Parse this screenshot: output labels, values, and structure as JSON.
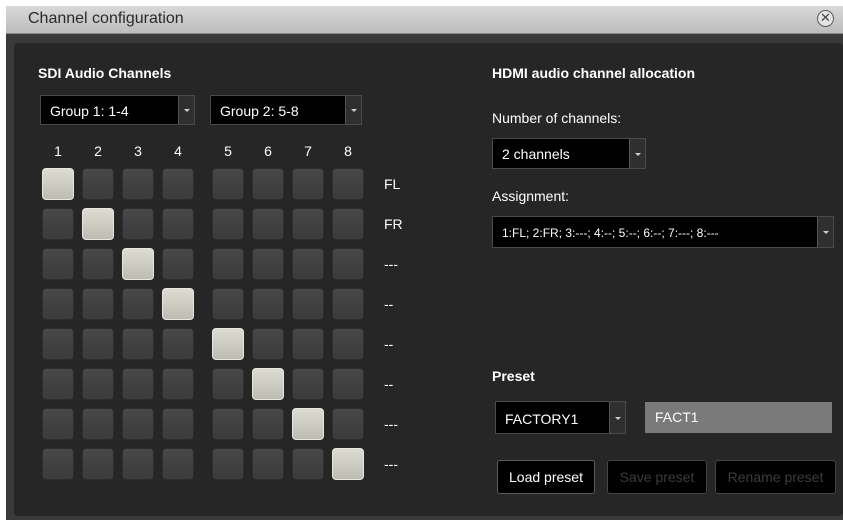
{
  "window": {
    "title": "Channel configuration"
  },
  "sdi": {
    "heading": "SDI Audio Channels",
    "group1": "Group 1: 1-4",
    "group2": "Group 2: 5-8",
    "columns": [
      "1",
      "2",
      "3",
      "4",
      "5",
      "6",
      "7",
      "8"
    ],
    "row_labels": [
      "FL",
      "FR",
      "---",
      "--",
      "--",
      "--",
      "---",
      "---"
    ],
    "selected_column_per_row": [
      1,
      2,
      3,
      4,
      5,
      6,
      7,
      8
    ]
  },
  "hdmi": {
    "heading": "HDMI audio channel allocation",
    "num_channels_label": "Number of channels:",
    "num_channels_value": "2 channels",
    "assignment_label": "Assignment:",
    "assignment_value": "1:FL; 2:FR; 3:---; 4:--; 5:--; 6:--; 7:---; 8:---"
  },
  "preset": {
    "heading": "Preset",
    "selected": "FACTORY1",
    "name_value": "FACT1",
    "load_label": "Load preset",
    "save_label": "Save preset",
    "rename_label": "Rename preset"
  }
}
